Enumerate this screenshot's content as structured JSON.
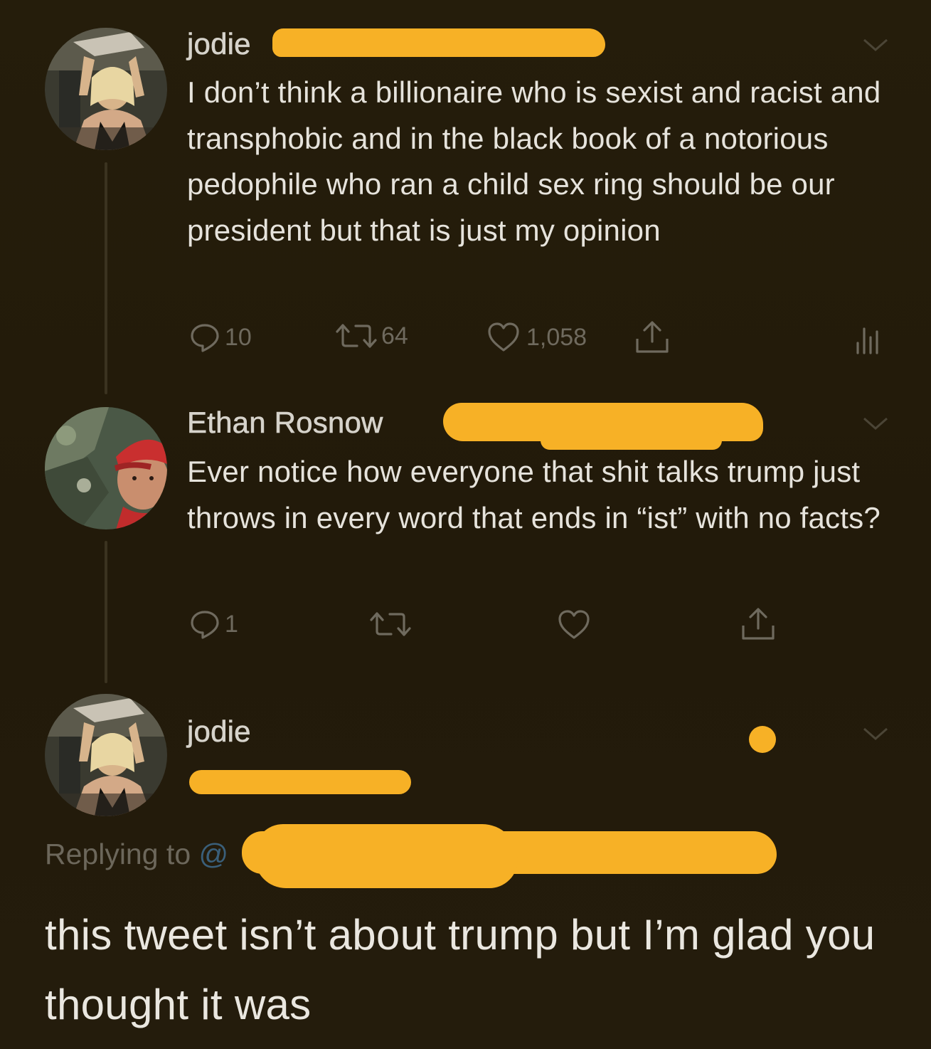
{
  "thread": {
    "tweets": [
      {
        "author": "jodie",
        "text": "I don’t think a billionaire who is sexist and racist and transphobic and in the black book of a notorious pedophile who ran a child sex ring should be our president but that is just my opinion",
        "replies": "10",
        "retweets": "64",
        "likes": "1,058"
      },
      {
        "author": "Ethan Rosnow",
        "text": "Ever notice how everyone that shit talks trump just throws in every word that ends in “ist” with no facts?",
        "replies": "1"
      }
    ],
    "focused_tweet": {
      "author": "jodie",
      "replying_to_label": "Replying to",
      "replying_to_prefix": "@",
      "text": "this tweet isn’t about trump but I’m glad you thought it was"
    }
  },
  "colors": {
    "background": "#241c0b",
    "redaction": "#f7b126",
    "text": "#e6e3dc",
    "muted": "#6f6a5e"
  },
  "icons": [
    "reply-icon",
    "retweet-icon",
    "like-icon",
    "share-icon",
    "analytics-icon",
    "chevron-down-icon"
  ]
}
